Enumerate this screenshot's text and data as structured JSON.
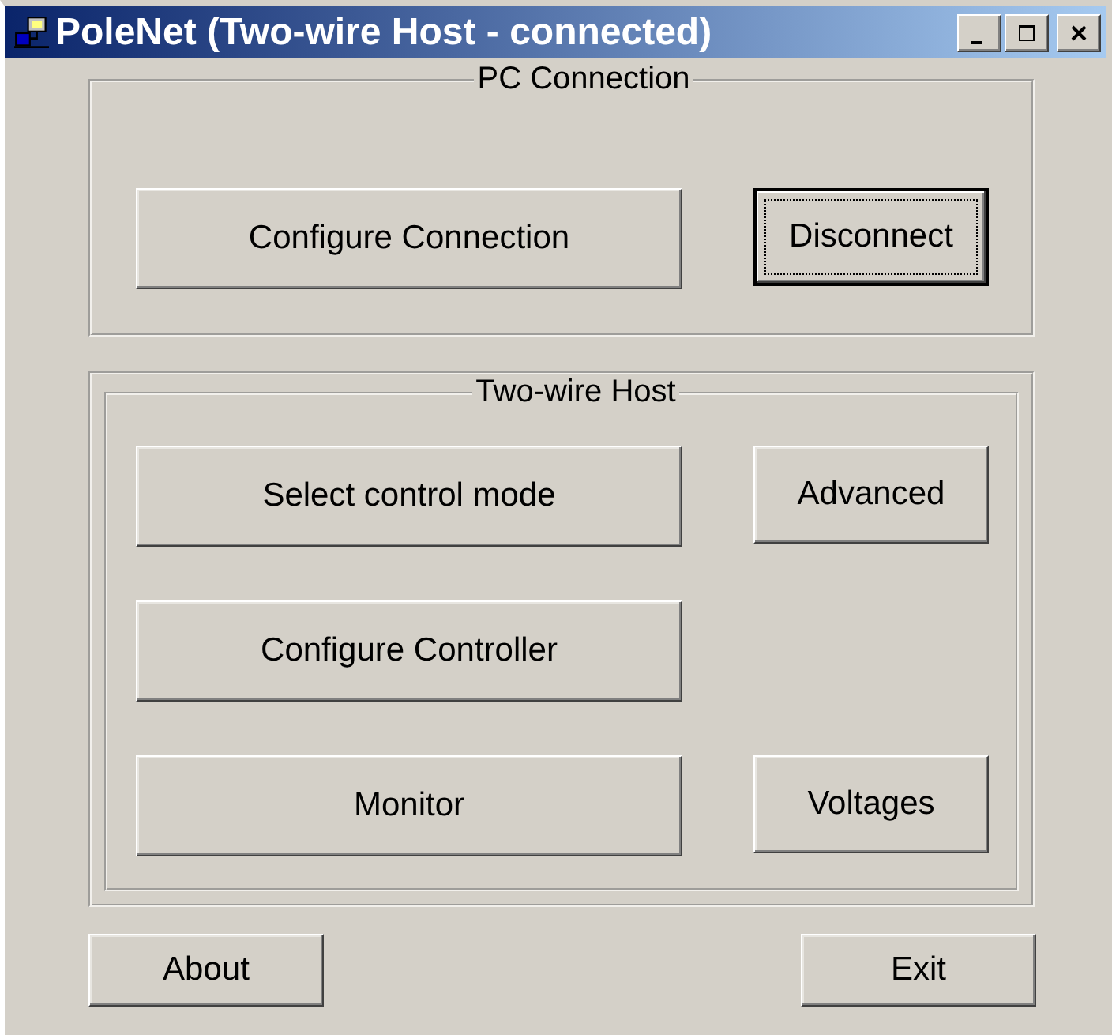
{
  "window": {
    "title": "PoleNet (Two-wire Host - connected)"
  },
  "groups": [
    {
      "title": "PC Connection",
      "kind": "single",
      "rows": [
        [
          {
            "label": "Configure Connection",
            "default": false,
            "focused": false,
            "kind": "wide"
          },
          {
            "label": "Disconnect",
            "default": true,
            "focused": true,
            "kind": "narrow"
          }
        ]
      ]
    },
    {
      "title": "Two-wire Host",
      "kind": "double",
      "rows": [
        [
          {
            "label": "Select control mode",
            "default": false,
            "focused": false,
            "kind": "wide"
          },
          {
            "label": "Advanced",
            "default": false,
            "focused": false,
            "kind": "narrow"
          }
        ],
        [
          {
            "label": "Configure Controller",
            "default": false,
            "focused": false,
            "kind": "wide"
          }
        ],
        [
          {
            "label": "Monitor",
            "default": false,
            "focused": false,
            "kind": "wide"
          },
          {
            "label": "Voltages",
            "default": false,
            "focused": false,
            "kind": "narrow"
          }
        ]
      ]
    }
  ],
  "bottom_buttons": [
    {
      "label": "About",
      "default": false,
      "focused": false
    },
    {
      "label": "Exit",
      "default": false,
      "focused": false
    }
  ]
}
